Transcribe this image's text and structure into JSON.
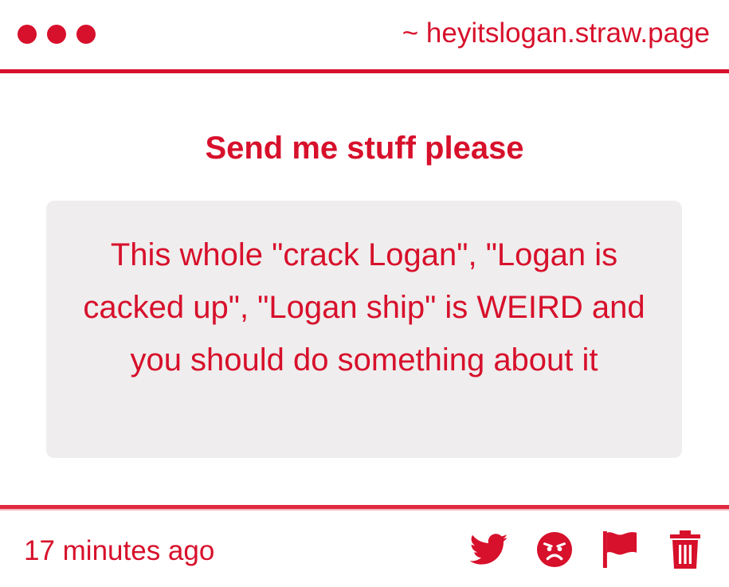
{
  "header": {
    "site_label": "~ heyitslogan.straw.page"
  },
  "post": {
    "title": "Send me stuff please",
    "message": "This whole \"crack Logan\", \"Logan is cacked up\", \"Logan ship\" is WEIRD and you should do something about it"
  },
  "footer": {
    "timestamp": "17 minutes ago",
    "actions": [
      "twitter-icon",
      "angry-face-icon",
      "flag-icon",
      "trash-icon"
    ]
  },
  "colors": {
    "accent": "#d7102b",
    "card_bg": "#efedee",
    "background": "#ffffff"
  }
}
